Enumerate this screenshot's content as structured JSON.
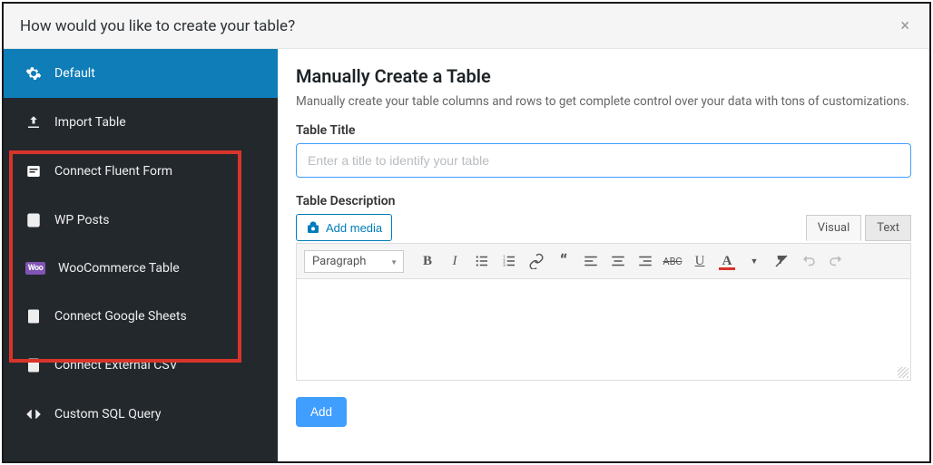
{
  "header": {
    "title": "How would you like to create your table?"
  },
  "sidebar": {
    "items": [
      {
        "icon": "gear",
        "label": "Default",
        "active": true
      },
      {
        "icon": "upload",
        "label": "Import Table"
      },
      {
        "icon": "form",
        "label": "Connect Fluent Form"
      },
      {
        "icon": "post",
        "label": "WP Posts"
      },
      {
        "icon": "woo",
        "label": "WooCommerce Table"
      },
      {
        "icon": "sheet",
        "label": "Connect Google Sheets"
      },
      {
        "icon": "csv",
        "label": "Connect External CSV"
      },
      {
        "icon": "code",
        "label": "Custom SQL Query"
      }
    ]
  },
  "content": {
    "heading": "Manually Create a Table",
    "description": "Manually create your table columns and rows to get complete control over your data with tons of customizations.",
    "title_label": "Table Title",
    "title_placeholder": "Enter a title to identify your table",
    "desc_label": "Table Description",
    "add_media_label": "Add media",
    "tabs": {
      "visual": "Visual",
      "text": "Text"
    },
    "paragraph_label": "Paragraph",
    "add_button": "Add"
  }
}
